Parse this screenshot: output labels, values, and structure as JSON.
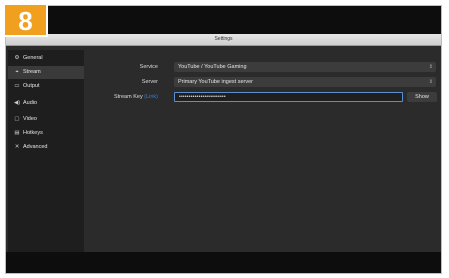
{
  "step_number": "8",
  "window": {
    "title": "Settings"
  },
  "sidebar": {
    "items": [
      {
        "label": "General",
        "icon": "gear-icon"
      },
      {
        "label": "Stream",
        "icon": "stream-icon"
      },
      {
        "label": "Output",
        "icon": "output-icon"
      },
      {
        "label": "Audio",
        "icon": "speaker-icon"
      },
      {
        "label": "Video",
        "icon": "monitor-icon"
      },
      {
        "label": "Hotkeys",
        "icon": "keyboard-icon"
      },
      {
        "label": "Advanced",
        "icon": "tools-icon"
      }
    ],
    "selected": "Stream"
  },
  "stream": {
    "service_label": "Service",
    "service_value": "YouTube / YouTube Gaming",
    "server_label": "Server",
    "server_value": "Primary YouTube ingest server",
    "key_label": "Stream Key",
    "key_link": "(Link)",
    "key_value": "••••••••••••••••••••••••",
    "show_label": "Show"
  },
  "colors": {
    "badge": "#f0a01e",
    "focus_border": "#5b8fd1",
    "link": "#3b7fd6"
  }
}
